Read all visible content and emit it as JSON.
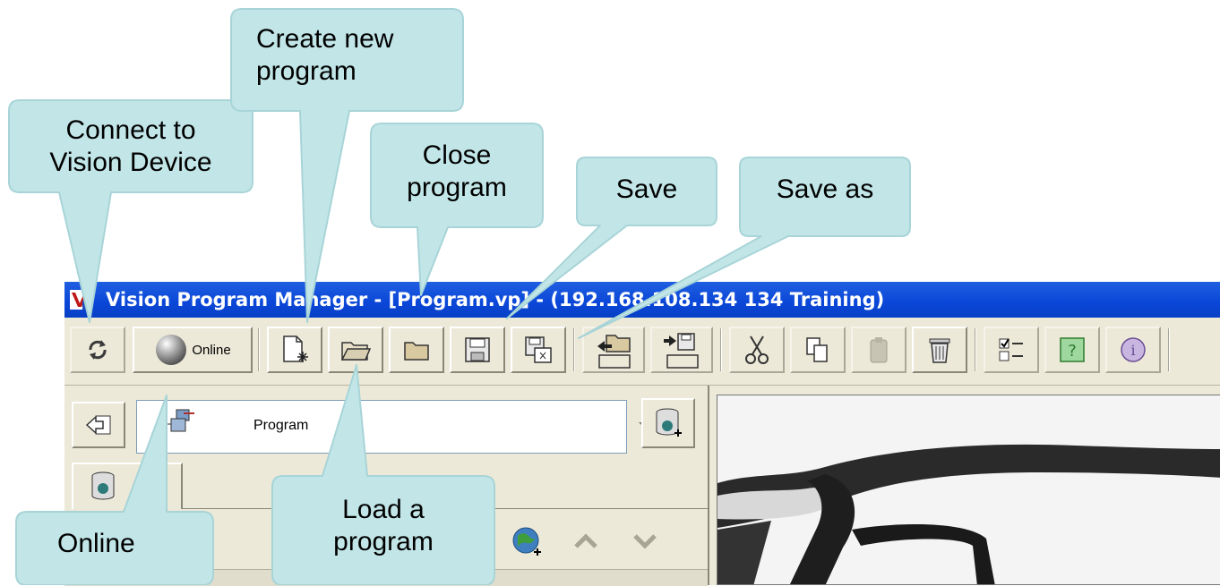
{
  "window": {
    "title": "Vision Program Manager - [Program.vp] - (192.168.108.134 134 Training)"
  },
  "toolbar": {
    "online_label": "Online",
    "buttons": [
      {
        "icon": "refresh-arrows-icon"
      },
      {
        "icon": "gray-sphere-icon"
      },
      {
        "icon": "new-document-icon"
      },
      {
        "icon": "open-folder-icon"
      },
      {
        "icon": "close-folder-icon"
      },
      {
        "icon": "floppy-save-icon"
      },
      {
        "icon": "floppy-save-as-icon"
      },
      {
        "icon": "folder-import-icon"
      },
      {
        "icon": "folder-export-icon"
      },
      {
        "icon": "scissors-icon"
      },
      {
        "icon": "copy-icon"
      },
      {
        "icon": "paste-icon"
      },
      {
        "icon": "trash-icon"
      },
      {
        "icon": "checklist-icon"
      },
      {
        "icon": "help-icon"
      },
      {
        "icon": "info-icon"
      }
    ]
  },
  "program_selector": {
    "value": "Program"
  },
  "callouts": {
    "connect": "Connect to\nVision Device",
    "create": "Create new\nprogram",
    "close": "Close\nprogram",
    "save": "Save",
    "save_as": "Save as",
    "online": "Online",
    "load": "Load a\nprogram"
  },
  "colors": {
    "titlebar": "#0a46d8",
    "chrome": "#ece9d8",
    "callout_fill": "#c2e6e8",
    "callout_stroke": "#a8d4d8"
  }
}
